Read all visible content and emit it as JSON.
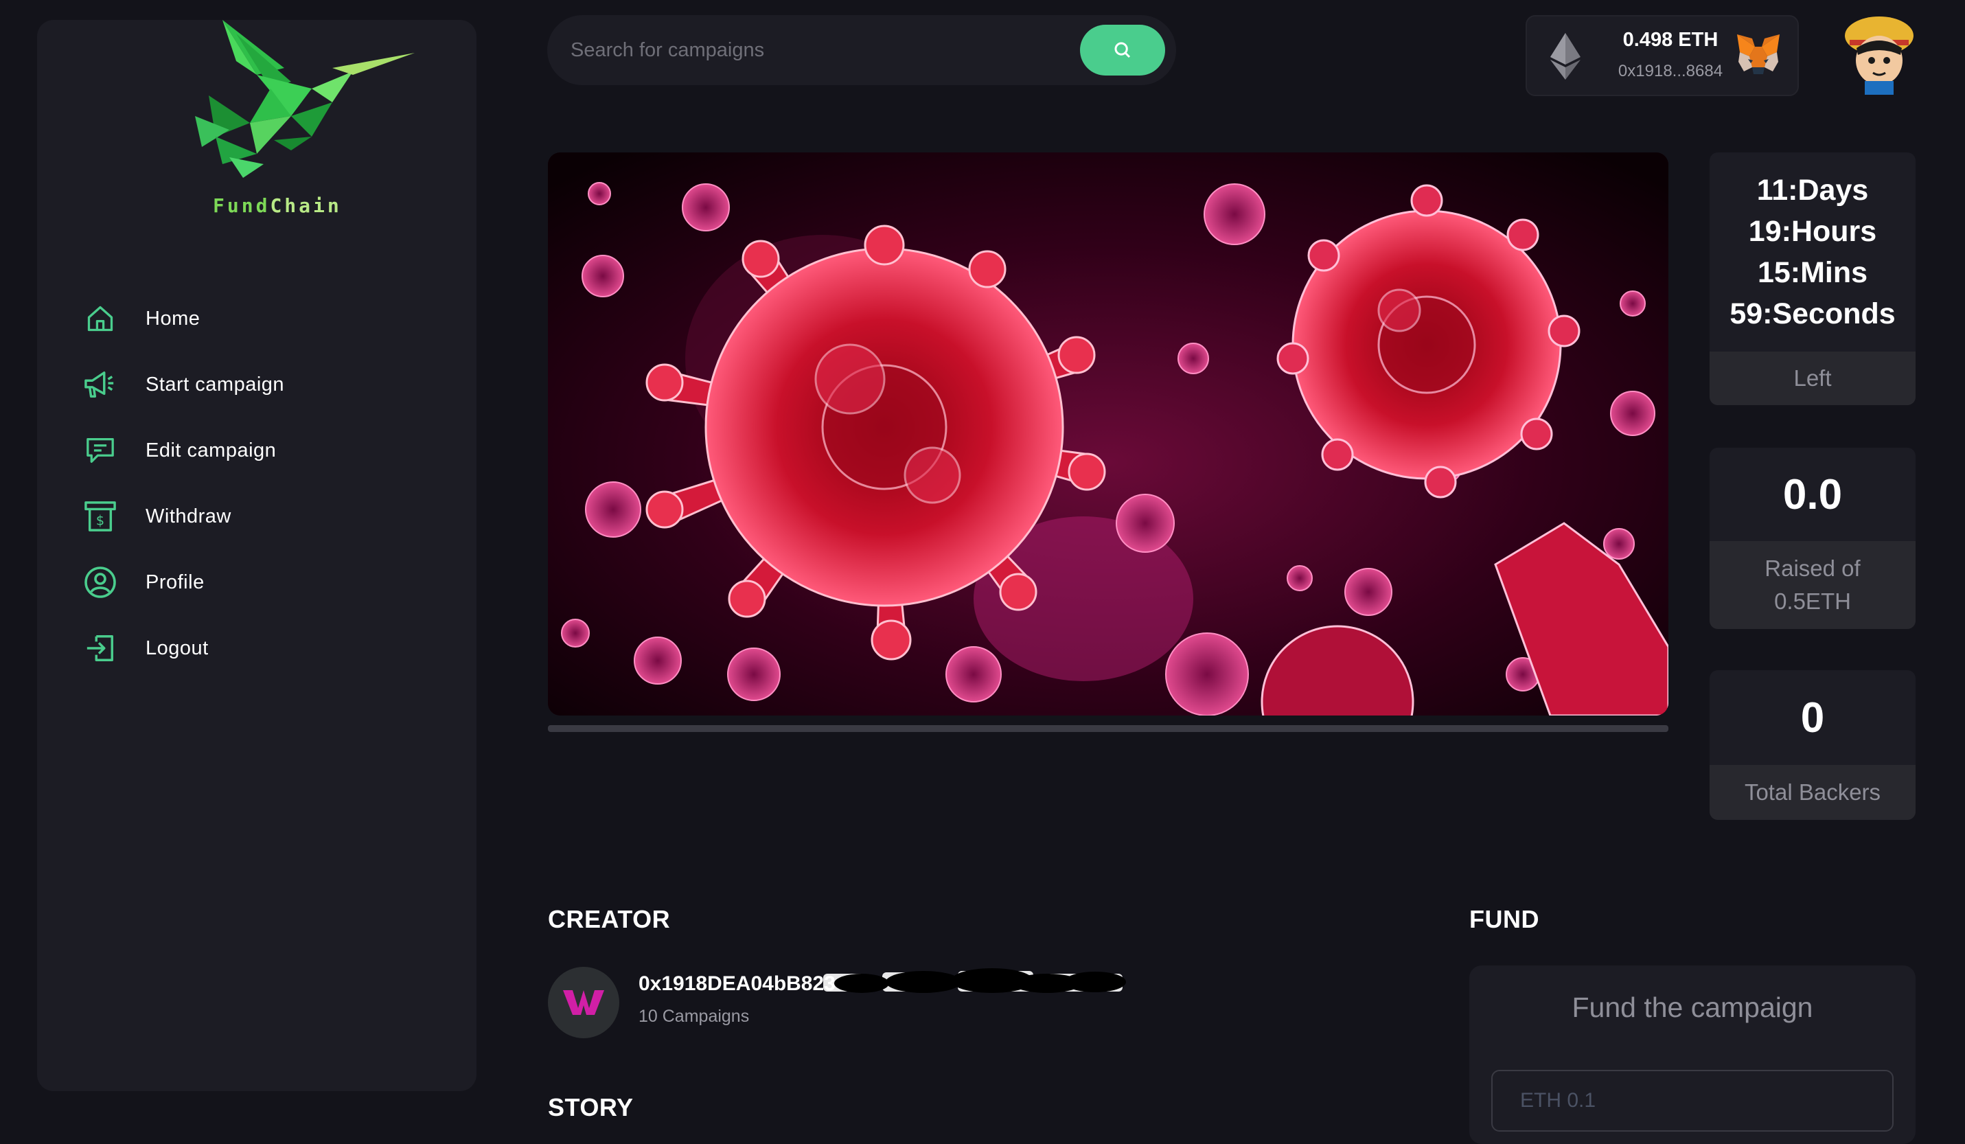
{
  "brand": {
    "name_part1": "Fund",
    "name_part2": "Chain"
  },
  "sidebar": {
    "items": [
      {
        "label": "Home",
        "icon": "home-icon"
      },
      {
        "label": "Start campaign",
        "icon": "megaphone-icon"
      },
      {
        "label": "Edit campaign",
        "icon": "edit-message-icon"
      },
      {
        "label": "Withdraw",
        "icon": "withdraw-icon"
      },
      {
        "label": "Profile",
        "icon": "profile-icon"
      },
      {
        "label": "Logout",
        "icon": "logout-icon"
      }
    ]
  },
  "search": {
    "placeholder": "Search for campaigns",
    "icon": "search-icon"
  },
  "wallet": {
    "balance": "0.498 ETH",
    "address": "0x1918...8684",
    "icons": [
      "ethereum-icon",
      "metamask-fox-icon"
    ]
  },
  "campaign": {
    "progress_percent": 0,
    "timer": {
      "days": "11:Days",
      "hours": "19:Hours",
      "mins": "15:Mins",
      "seconds": "59:Seconds",
      "label": "Left"
    },
    "raised": {
      "value": "0.0",
      "label": "Raised of 0.5ETH"
    },
    "backers": {
      "value": "0",
      "label": "Total Backers"
    }
  },
  "creator": {
    "heading": "CREATOR",
    "address": "0x1918DEA04bB823",
    "campaigns": "10 Campaigns"
  },
  "story": {
    "heading": "STORY"
  },
  "fund": {
    "heading": "FUND",
    "title": "Fund the campaign",
    "placeholder": "ETH 0.1"
  },
  "colors": {
    "accent": "#4acd8d",
    "background": "#13131a",
    "card": "#1c1c24"
  }
}
